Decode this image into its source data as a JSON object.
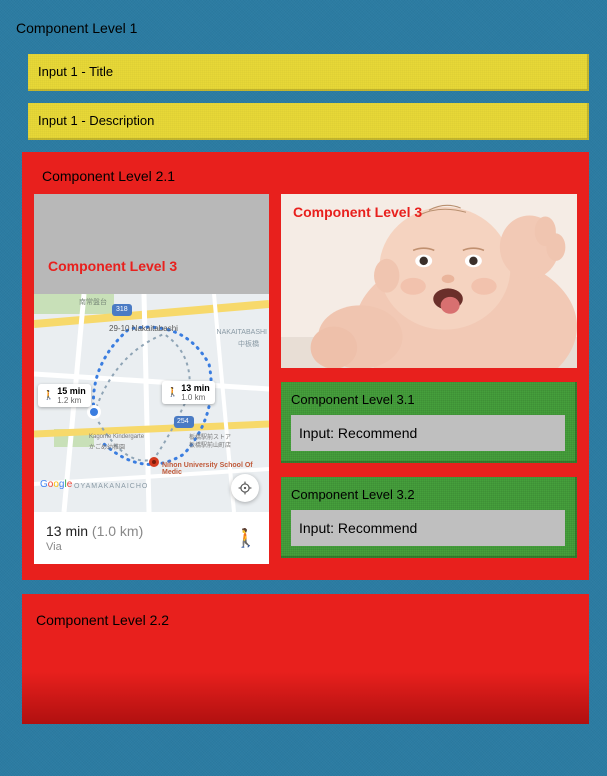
{
  "level1": {
    "title": "Component Level 1"
  },
  "inputs": {
    "input1_title": "Input 1 - Title",
    "input1_description": "Input 1 - Description"
  },
  "level2_1": {
    "title": "Component Level 2.1"
  },
  "level2_2": {
    "title": "Component Level 2.2"
  },
  "map": {
    "level3_label": "Component Level 3",
    "time_text": "13 min",
    "distance_text": "(1.0 km)",
    "via_text": "Via",
    "bubble1_walk": "🚶",
    "bubble1_time": "15 min",
    "bubble1_dist": "1.2 km",
    "bubble2_walk": "🚶",
    "bubble2_time": "13 min",
    "bubble2_dist": "1.0 km",
    "label_nakaitabashi": "29-10 Nakaitabashi",
    "label_oyamakanacho": "OYAMAKANAICHO",
    "label_school": "Nihon University School Of Medic",
    "label_nakaitabashi2": "NAKAITABASHI",
    "label_nakaitacho": "中板橋",
    "label_google": "Google",
    "label_318": "318",
    "label_254": "254",
    "label_kagome": "Kagome Kindergarte",
    "label_kagome_jp": "かごめ幼稚園",
    "label_store": "板橋駅前ストア",
    "label_store2": "板橋駅前山町店",
    "label_minamicho": "南常盤台"
  },
  "baby": {
    "level3_label": "Component Level 3"
  },
  "level3_1": {
    "title": "Component Level 3.1",
    "placeholder": "Input: Recommend"
  },
  "level3_2": {
    "title": "Component Level 3.2",
    "placeholder": "Input: Recommend"
  }
}
